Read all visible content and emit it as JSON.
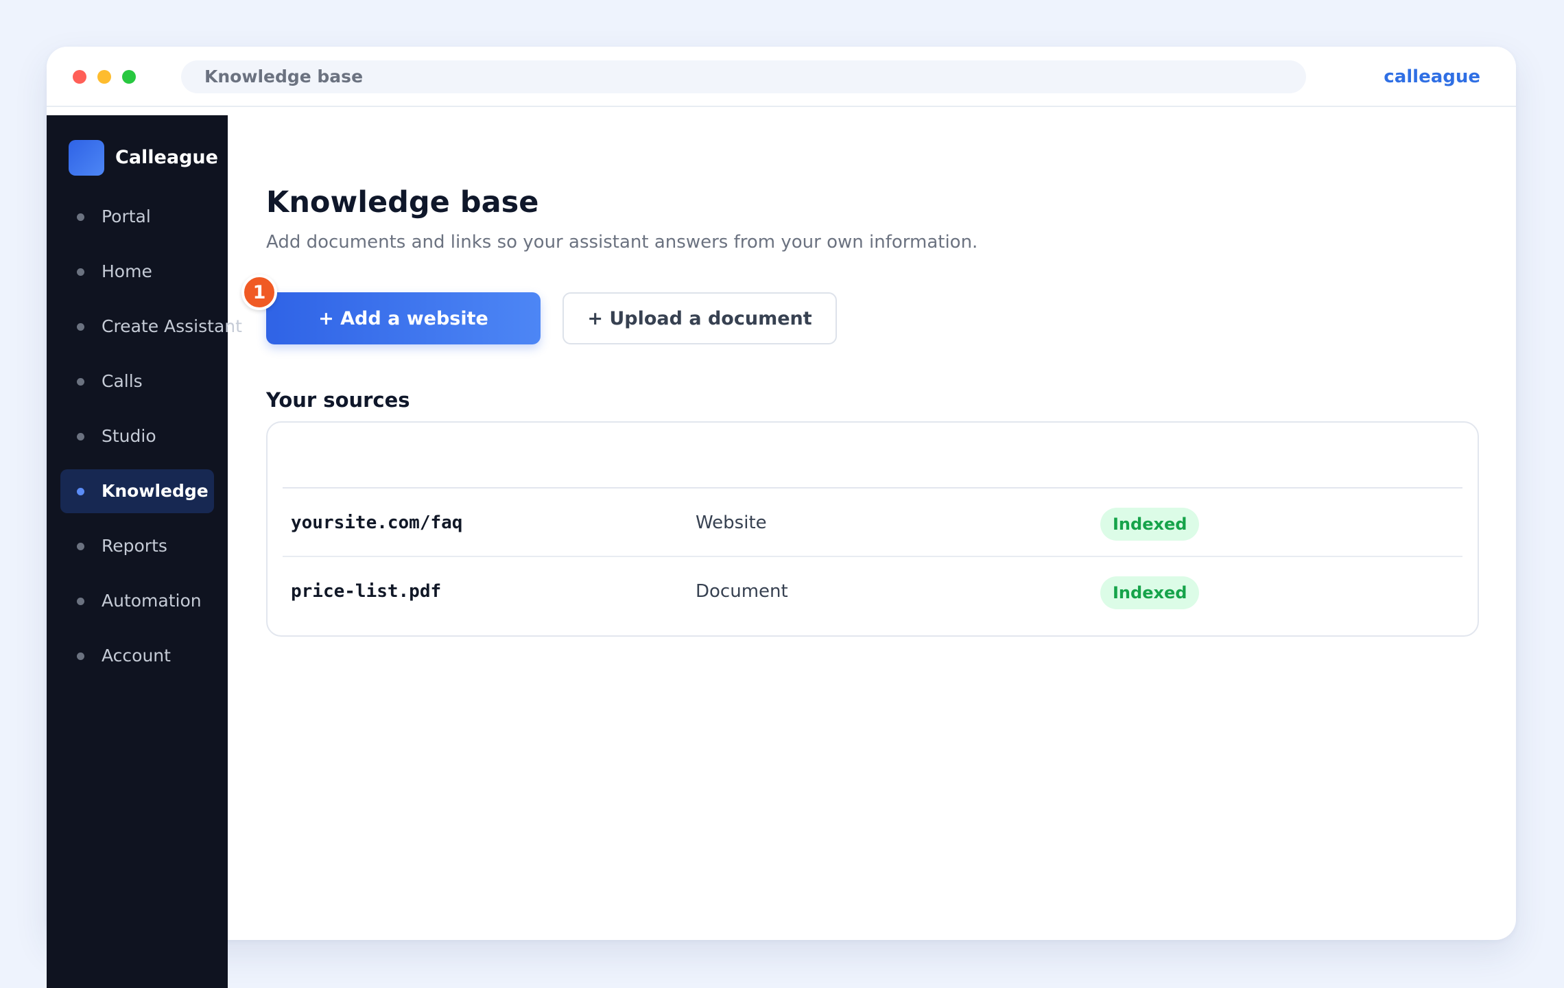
{
  "window": {
    "url_text": "Knowledge base",
    "brand_link": "calleague"
  },
  "sidebar": {
    "brand": "Calleague",
    "active_item": "Knowledge",
    "items": [
      {
        "label": "Portal"
      },
      {
        "label": "Home"
      },
      {
        "label": "Create Assistant"
      },
      {
        "label": "Calls"
      },
      {
        "label": "Studio"
      },
      {
        "label": "Knowledge"
      },
      {
        "label": "Reports"
      },
      {
        "label": "Automation"
      },
      {
        "label": "Account"
      }
    ]
  },
  "main": {
    "title": "Knowledge base",
    "subtitle": "Add documents and links so your assistant answers from your own information.",
    "step_badge": "1",
    "add_website_label": "+ Add a website",
    "upload_document_label": "+ Upload a document",
    "sources_title": "Your sources",
    "sources": [
      {
        "name": "yoursite.com/faq",
        "type": "Website",
        "status": "Indexed"
      },
      {
        "name": "price-list.pdf",
        "type": "Document",
        "status": "Indexed"
      }
    ]
  },
  "colors": {
    "accent": "#2f63e6",
    "sidebar_bg": "#0f1320",
    "step_badge": "#f05a24",
    "status_text": "#16a34a",
    "status_bg": "#dcfce7"
  },
  "icons": {
    "window_controls": [
      "close-dot",
      "minimize-dot",
      "maximize-dot"
    ],
    "logo": "brand-square-icon",
    "nav_bullet": "dot-icon"
  }
}
